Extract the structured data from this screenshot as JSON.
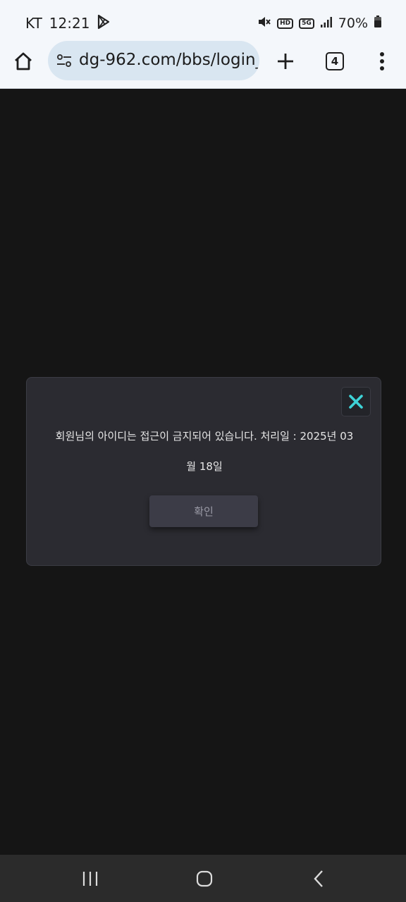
{
  "status_bar": {
    "carrier": "KT",
    "time": "12:21",
    "hd_badge": "HD",
    "network_badge": "5G",
    "battery": "70%"
  },
  "browser": {
    "url": "dg-962.com/bbs/login_",
    "tab_count": "4"
  },
  "dialog": {
    "message_line1": "회원님의 아이디는 접근이 금지되어 있습니다. 처리일 : 2025년 03",
    "message_line2": "월 18일",
    "confirm_label": "확인",
    "close_icon_color": "#3ed3d7"
  },
  "colors": {
    "page_background": "#151515",
    "dialog_background": "#2b2b31",
    "browser_bar": "#f4f7fb",
    "url_pill": "#d9e6f1"
  }
}
